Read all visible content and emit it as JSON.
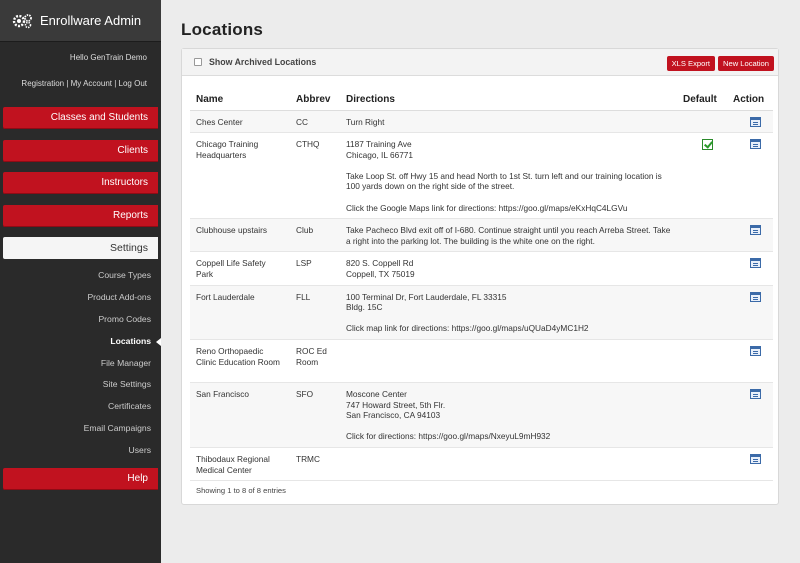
{
  "sidebar": {
    "brand": "Enrollware Admin",
    "hello": "Hello GenTrain Demo",
    "links": [
      "Registration",
      "My Account",
      "Log Out"
    ],
    "menu": [
      {
        "label": "Classes and Students"
      },
      {
        "label": "Clients"
      },
      {
        "label": "Instructors"
      },
      {
        "label": "Reports"
      }
    ],
    "settings_label": "Settings",
    "submenu": [
      {
        "label": "Course Types"
      },
      {
        "label": "Product Add-ons"
      },
      {
        "label": "Promo Codes"
      },
      {
        "label": "Locations",
        "active": true
      },
      {
        "label": "File Manager"
      },
      {
        "label": "Site Settings"
      },
      {
        "label": "Certificates"
      },
      {
        "label": "Email Campaigns"
      },
      {
        "label": "Users"
      }
    ],
    "help_label": "Help"
  },
  "page": {
    "title": "Locations",
    "show_archived_label": "Show Archived Locations",
    "xls_export_label": "XLS Export",
    "new_location_label": "New Location",
    "columns": [
      "Name",
      "Abbrev",
      "Directions",
      "Default",
      "Action"
    ],
    "rows": [
      {
        "name": "Ches Center",
        "abbrev": "CC",
        "directions": [
          "Turn Right"
        ],
        "default": false
      },
      {
        "name": "Chicago Training Headquarters",
        "abbrev": "CTHQ",
        "directions": [
          "1187 Training Ave\nChicago, IL 66771",
          "Take Loop St. off Hwy 15 and head North to 1st St. turn left and our training location is 100 yards down on the right side of the street.",
          "Click the Google Maps link for directions: https://goo.gl/maps/eKxHqC4LGVu"
        ],
        "default": true
      },
      {
        "name": "Clubhouse upstairs",
        "abbrev": "Club",
        "directions": [
          "Take Pacheco Blvd exit off of I-680. Continue straight until you reach Arreba Street. Take a right into the parking lot. The building is the white one on the right."
        ],
        "default": false
      },
      {
        "name": "Coppell Life Safety Park",
        "abbrev": "LSP",
        "directions": [
          "820 S. Coppell Rd\nCoppell, TX 75019"
        ],
        "default": false
      },
      {
        "name": "Fort Lauderdale",
        "abbrev": "FLL",
        "directions": [
          "100 Terminal Dr, Fort Lauderdale, FL 33315\nBldg. 15C",
          "Click map link for directions: https://goo.gl/maps/uQUaD4yMC1H2"
        ],
        "default": false
      },
      {
        "name": "Reno Orthopaedic Clinic Education Room",
        "abbrev": "ROC Ed Room",
        "directions": [],
        "default": false
      },
      {
        "name": "San Francisco",
        "abbrev": "SFO",
        "directions": [
          "Moscone Center\n747 Howard Street, 5th Flr.\nSan Francisco, CA 94103",
          "Click for directions: https://goo.gl/maps/NxeyuL9mH932"
        ],
        "default": false
      },
      {
        "name": "Thibodaux Regional Medical Center",
        "abbrev": "TRMC",
        "directions": [],
        "default": false
      }
    ],
    "footer": "Showing 1 to 8 of 8 entries"
  },
  "colors": {
    "accent": "#c1121f",
    "sidebar": "#2a2a2a"
  },
  "icons": {
    "brand": "gears-icon",
    "edit": "edit-icon",
    "default": "checkmark-icon"
  }
}
